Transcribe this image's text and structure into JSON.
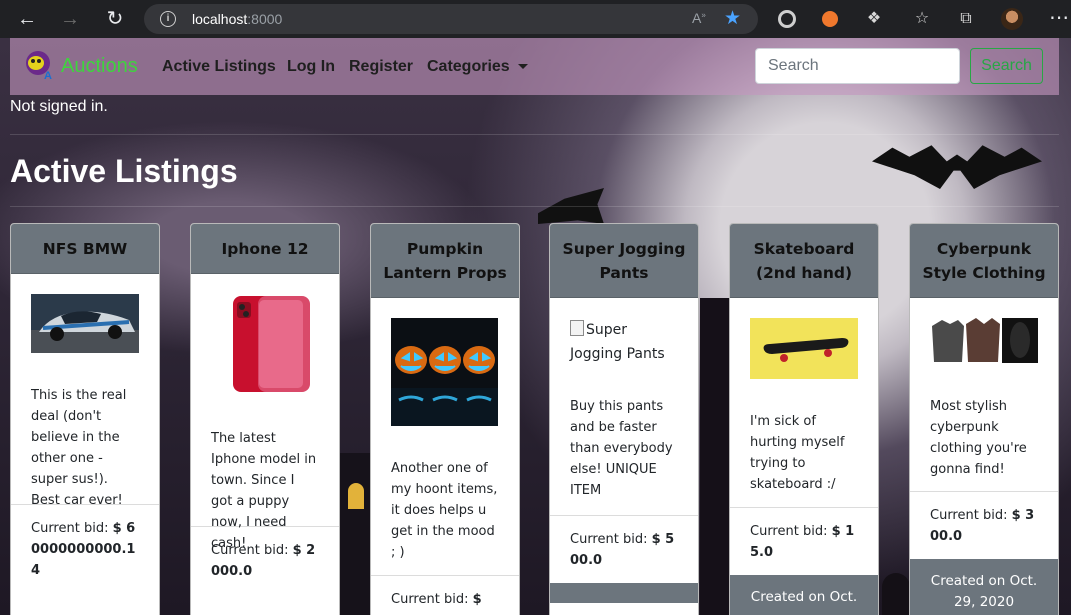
{
  "browser": {
    "url_host": "localhost",
    "url_port": ":8000"
  },
  "navbar": {
    "brand": "Auctions",
    "links": [
      "Active Listings",
      "Log In",
      "Register",
      "Categories"
    ],
    "search_placeholder": "Search",
    "search_button": "Search"
  },
  "status": "Not signed in.",
  "heading": "Active Listings",
  "listings": [
    {
      "title": "NFS BMW",
      "description": "This is the real deal (don't believe in the other one - super sus!). Best car ever!",
      "bid_label": "Current bid:",
      "bid_value": "$ 60000000000.14",
      "image": "car-image"
    },
    {
      "title": "Iphone 12",
      "description": "The latest Iphone model in town. Since I got a puppy now, I need cash!",
      "bid_label": "Current bid:",
      "bid_value": "$ 2000.0",
      "image": "phone-image"
    },
    {
      "title": "Pumpkin Lantern Props",
      "description": "Another one of my hoont items, it does helps u get in the mood ; )",
      "bid_label": "Current bid:",
      "bid_value": "$",
      "image": "pumpkin-image"
    },
    {
      "title": "Super Jogging Pants",
      "image_alt": "Super Jogging Pants",
      "description": "Buy this pants and be faster than everybody else! UNIQUE ITEM",
      "bid_label": "Current bid:",
      "bid_value": "$ 500.0",
      "image": "broken-image"
    },
    {
      "title": "Skateboard (2nd hand)",
      "description": "I'm sick of hurting myself trying to skateboard :/",
      "bid_label": "Current bid:",
      "bid_value": "$ 15.0",
      "footer": "Created on Oct.",
      "image": "skateboard-image"
    },
    {
      "title": "Cyberpunk Style Clothing",
      "description": "Most stylish cyberpunk clothing you're gonna find!",
      "bid_label": "Current bid:",
      "bid_value": "$ 300.0",
      "footer": "Created on Oct. 29, 2020",
      "image": "jackets-image"
    }
  ]
}
